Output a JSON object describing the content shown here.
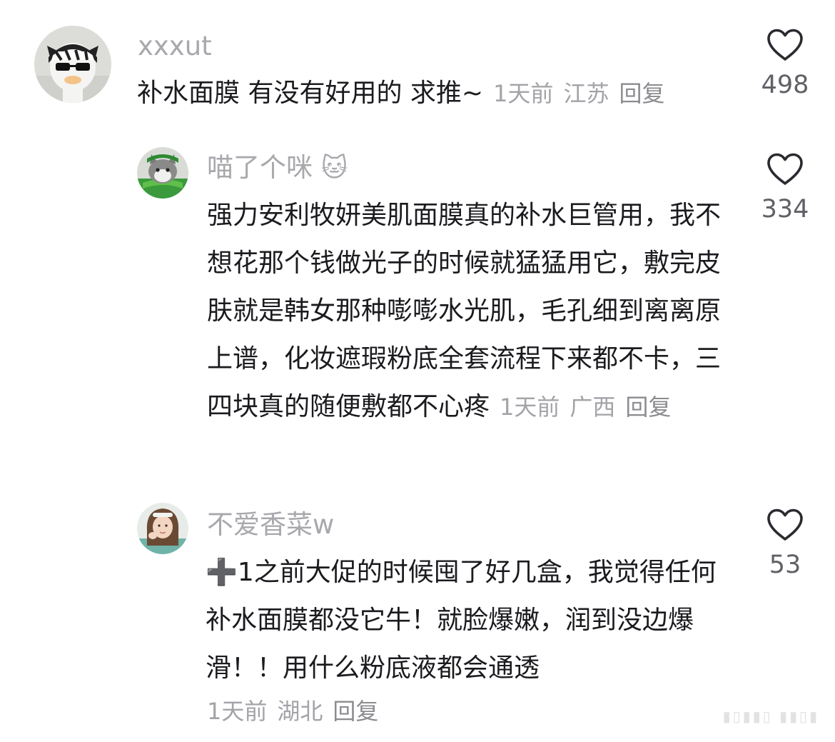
{
  "comments": [
    {
      "username": "xxxut",
      "text": "补水面膜 有没有好用的 求推~",
      "time": "1天前",
      "location": "江苏",
      "reply_label": "回复",
      "likes": "498",
      "avatar_icon": "zebra-duck-avatar"
    },
    {
      "username": "喵了个咪",
      "username_emoji": "🐱",
      "text": "强力安利牧妍美肌面膜真的补水巨管用，我不想花那个钱做光子的时候就猛猛用它，敷完皮肤就是韩女那种嘭嘭水光肌，毛孔细到离离原上谱，化妆遮瑕粉底全套流程下来都不卡，三四块真的随便敷都不心疼",
      "time": "1天前",
      "location": "广西",
      "reply_label": "回复",
      "likes": "334",
      "avatar_icon": "cat-avatar"
    },
    {
      "username": "不爱香菜w",
      "text": "➕1之前大促的时候囤了好几盒，我觉得任何补水面膜都没它牛！就脸爆嫩，润到没边爆滑！！用什么粉底液都会通透",
      "time": "1天前",
      "location": "湖北",
      "reply_label": "回复",
      "likes": "53",
      "avatar_icon": "girl-avatar"
    }
  ]
}
